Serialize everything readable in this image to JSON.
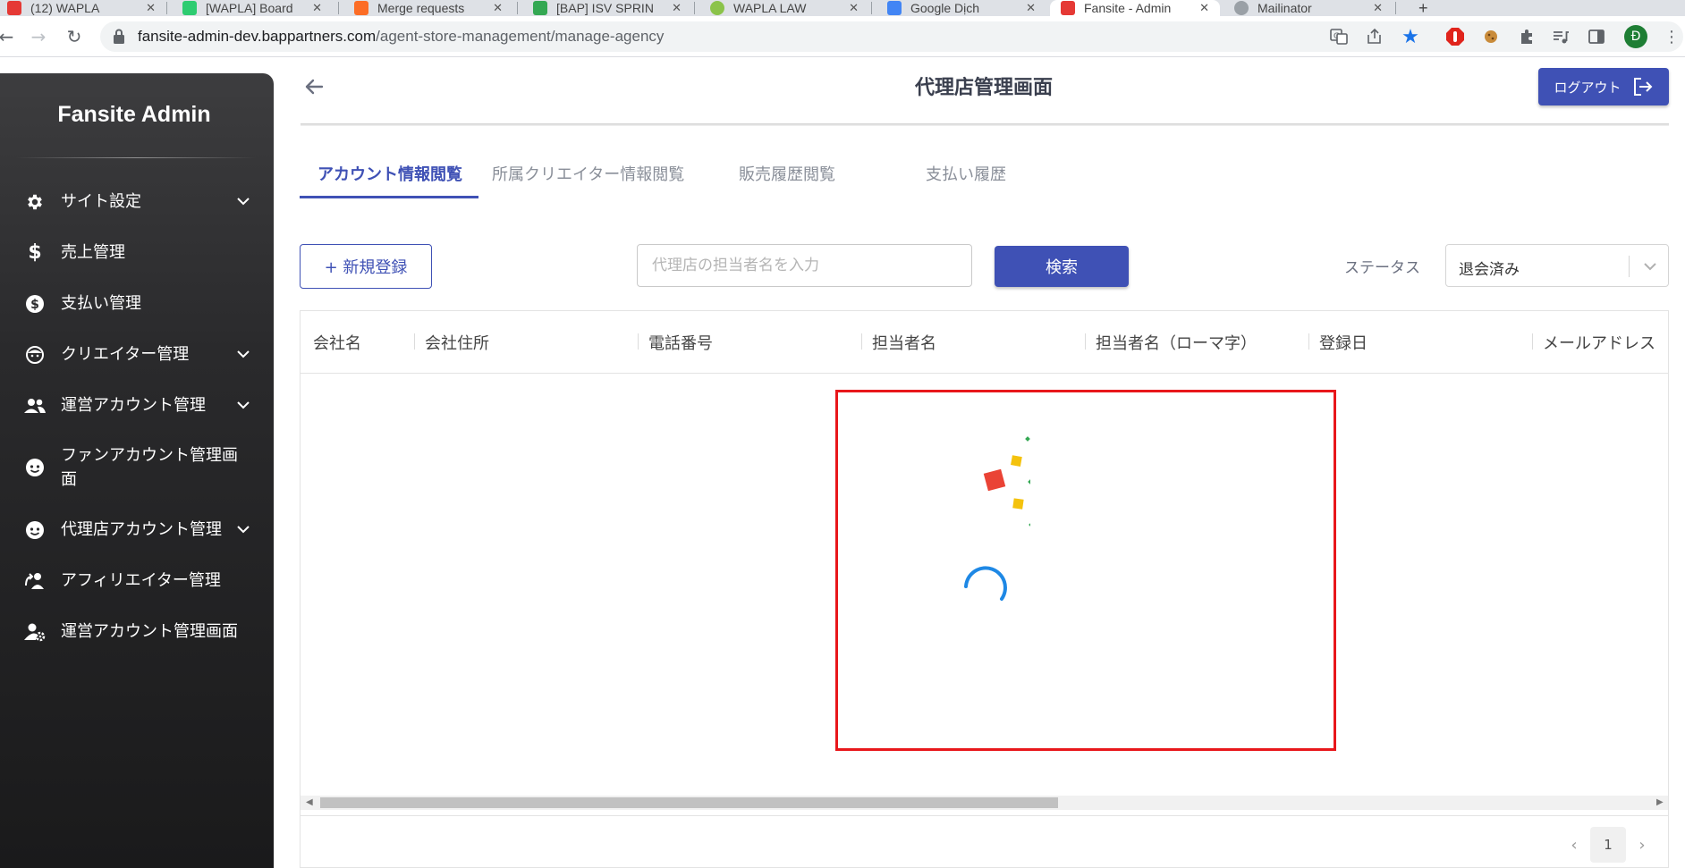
{
  "browser": {
    "url_host": "fansite-admin-dev.bappartners.com",
    "url_path": "/agent-store-management/manage-agency",
    "tabs": [
      {
        "label": "(12) WAPLA"
      },
      {
        "label": "[WAPLA] Board"
      },
      {
        "label": "Merge requests"
      },
      {
        "label": "[BAP] ISV SPRIN"
      },
      {
        "label": "WAPLA LAW"
      },
      {
        "label": "Google Dịch"
      },
      {
        "label": "Fansite - Admin"
      },
      {
        "label": "Mailinator"
      }
    ],
    "profile_initial": "Đ"
  },
  "sidebar": {
    "brand": "Fansite Admin",
    "items": [
      {
        "label": "サイト設定",
        "icon": "gear-icon",
        "has_submenu": true
      },
      {
        "label": "売上管理",
        "icon": "dollar-icon",
        "has_submenu": false
      },
      {
        "label": "支払い管理",
        "icon": "coin-icon",
        "has_submenu": false
      },
      {
        "label": "クリエイター管理",
        "icon": "face-icon",
        "has_submenu": true
      },
      {
        "label": "運営アカウント管理",
        "icon": "people-icon",
        "has_submenu": true
      },
      {
        "label": "ファンアカウント管理画面",
        "icon": "fan-face-icon",
        "has_submenu": false
      },
      {
        "label": "代理店アカウント管理",
        "icon": "agency-face-icon",
        "has_submenu": true
      },
      {
        "label": "アフィリエイター管理",
        "icon": "affiliate-icon",
        "has_submenu": false
      },
      {
        "label": "運営アカウント管理画面",
        "icon": "user-gear-icon",
        "has_submenu": false
      }
    ]
  },
  "header": {
    "title": "代理店管理画面",
    "logout_label": "ログアウト"
  },
  "tabs": [
    {
      "label": "アカウント情報閲覧",
      "active": true
    },
    {
      "label": "所属クリエイター情報閲覧",
      "active": false
    },
    {
      "label": "販売履歴閲覧",
      "active": false
    },
    {
      "label": "支払い履歴",
      "active": false
    }
  ],
  "toolbar": {
    "new_label": "+ 新規登録",
    "search_placeholder": "代理店の担当者名を入力",
    "search_button": "検索",
    "status_label": "ステータス",
    "status_value": "退会済み"
  },
  "table": {
    "columns": [
      "会社名",
      "会社住所",
      "電話番号",
      "担当者名",
      "担当者名（ローマ字）",
      "登録日",
      "メールアドレス"
    ],
    "rows": []
  },
  "pagination": {
    "current_page": "1"
  },
  "colors": {
    "primary": "#3f51b5",
    "highlight_border": "#e8171b",
    "spinner": "#1e88e5"
  }
}
